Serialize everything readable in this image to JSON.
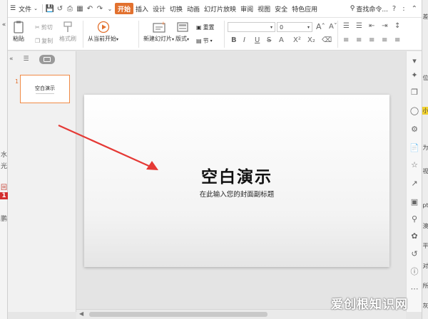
{
  "behind_left": [
    "«",
    "水",
    "光",
    "回",
    "鹏",
    "1"
  ],
  "behind_right": [
    "差",
    "位",
    "小",
    "为",
    "视",
    "pt",
    "澳",
    "平",
    "对",
    "所",
    "灰"
  ],
  "menubar": {
    "file": "文件",
    "tabs": [
      "开始",
      "插入",
      "设计",
      "切换",
      "动画",
      "幻灯片放映",
      "审阅",
      "视图",
      "安全",
      "特色应用"
    ],
    "search": "查找命令..."
  },
  "ribbon": {
    "paste": "粘贴",
    "cut": "剪切",
    "copy": "复制",
    "format_painter": "格式刷",
    "play_from_current": "从当前开始",
    "new_slide": "新建幻灯片",
    "layout": "版式",
    "reset": "重置",
    "section": "节",
    "font_size": "0",
    "bold": "B",
    "italic": "I",
    "underline": "U",
    "strike": "S"
  },
  "slide": {
    "number": "1",
    "thumb_title": "空白演示",
    "title": "空白演示",
    "subtitle": "在此输入您的封面副标题"
  },
  "watermark": "爱创根知识网",
  "colors": {
    "accent": "#e2712f",
    "arrow": "#e53935"
  }
}
